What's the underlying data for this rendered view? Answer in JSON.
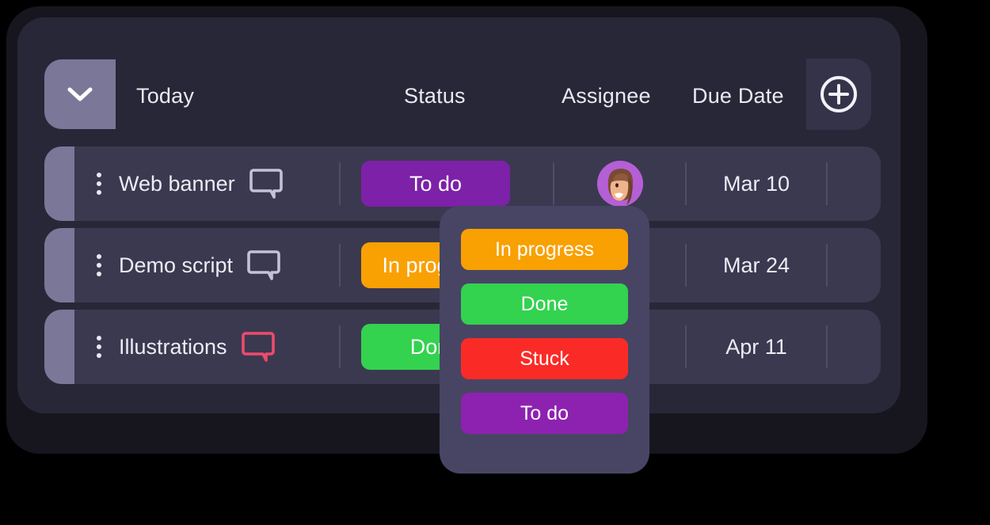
{
  "header": {
    "collapse_icon": "chevron-down-icon",
    "group_label": "Today",
    "columns": [
      {
        "label": "Status"
      },
      {
        "label": "Assignee"
      },
      {
        "label": "Due Date"
      }
    ],
    "add_icon": "plus-circle-icon",
    "add_label": "Add column"
  },
  "rows": [
    {
      "menu_icon": "kebab-menu-icon",
      "name": "Web banner",
      "comment_icon": "comment-icon",
      "comment_color": "#c3c2d6",
      "status": {
        "label": "To do",
        "color": "#7d21a8"
      },
      "assignee": {
        "avatar_icon": "person-avatar-icon",
        "avatar_bg": "#b45fd6"
      },
      "due_date": "Mar 10"
    },
    {
      "menu_icon": "kebab-menu-icon",
      "name": "Demo script",
      "comment_icon": "comment-icon",
      "comment_color": "#c3c2d6",
      "status": {
        "label": "In progress",
        "color": "#f9a003"
      },
      "assignee": {
        "avatar_icon": "person-avatar-icon",
        "avatar_bg": "#b45fd6"
      },
      "due_date": "Mar 24"
    },
    {
      "menu_icon": "kebab-menu-icon",
      "name": "Illustrations",
      "comment_icon": "comment-icon",
      "comment_color": "#ef4a6d",
      "status": {
        "label": "Done",
        "color": "#33d24f"
      },
      "assignee": {
        "avatar_icon": "person-avatar-icon",
        "avatar_bg": "#b45fd6"
      },
      "due_date": "Apr 11"
    }
  ],
  "dropdown": {
    "options": [
      {
        "label": "In progress",
        "color": "#f9a003"
      },
      {
        "label": "Done",
        "color": "#33d24f"
      },
      {
        "label": "Stuck",
        "color": "#fa2b27"
      },
      {
        "label": "To do",
        "color": "#8d22b0"
      }
    ]
  },
  "colors": {
    "page_background": "#000000",
    "backdrop": "#17161f",
    "card": "#282737",
    "row": "#3b3950",
    "row_accent": "#7b7799",
    "divider": "#4f4d68",
    "dropdown_panel": "#474563",
    "text": "#ecebf3"
  }
}
